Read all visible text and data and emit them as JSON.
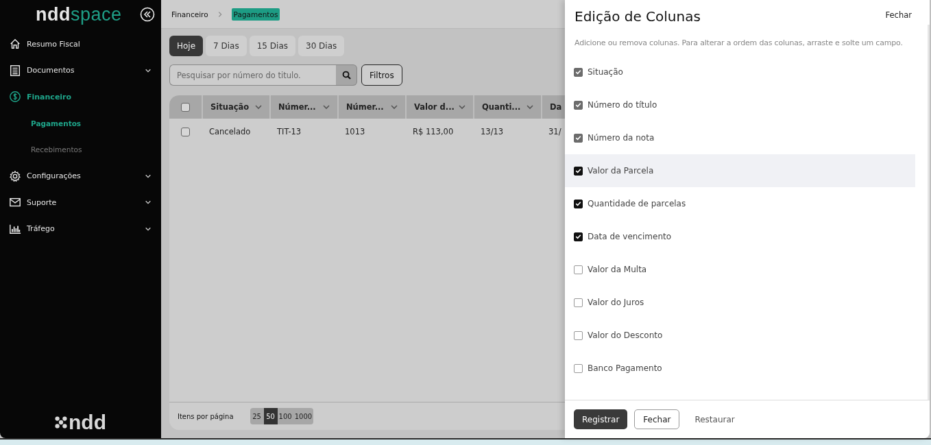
{
  "sidebar": {
    "logo": {
      "part_1": "ndd",
      "part_2": "space"
    },
    "items": [
      {
        "label": "Resumo Fiscal",
        "selected": false
      },
      {
        "label": "Documentos",
        "selected": false,
        "expanded": false
      },
      {
        "label": "Financeiro",
        "selected": true,
        "expanded": true,
        "children": [
          {
            "label": "Pagamentos",
            "selected": true
          },
          {
            "label": "Recebimentos",
            "selected": false
          }
        ]
      },
      {
        "label": "Configurações",
        "selected": false,
        "expanded": false
      },
      {
        "label": "Suporte",
        "selected": false,
        "expanded": false
      },
      {
        "label": "Tráfego",
        "selected": false,
        "expanded": false
      }
    ],
    "footer_logo": "ndd"
  },
  "breadcrumb": [
    {
      "label": "Financeiro",
      "selected": false
    },
    {
      "label": "Pagamentos",
      "selected": true
    }
  ],
  "period_tabs": [
    {
      "label": "Hoje",
      "selected": true
    },
    {
      "label": "7 Dias",
      "selected": false
    },
    {
      "label": "15 Dias",
      "selected": false
    },
    {
      "label": "30 Dias",
      "selected": false
    }
  ],
  "search": {
    "placeholder": "Pesquisar por número do titulo."
  },
  "filters_button": "Filtros",
  "table": {
    "select_all_checked": false,
    "columns": [
      "Situação",
      "Númer...",
      "Númer...",
      "Valor d...",
      "Quanti...",
      "Da"
    ],
    "rows": [
      {
        "checked": false,
        "cells": [
          "Cancelado",
          "TIT-13",
          "1013",
          "R$ 113,00",
          "13/13",
          "31/"
        ]
      }
    ]
  },
  "pagination": {
    "label": "Itens por página",
    "sizes": [
      {
        "label": "25",
        "selected": false
      },
      {
        "label": "50",
        "selected": true
      },
      {
        "label": "100",
        "selected": false
      },
      {
        "label": "1000",
        "selected": false
      }
    ]
  },
  "drawer": {
    "title": "Edição de Colunas",
    "close_link": "Fechar",
    "description": "Adicione ou remova colunas. Para alterar a ordem das colunas, arraste e solte um campo.",
    "options": [
      {
        "label": "Situação",
        "checked": true,
        "disabled": true,
        "highlighted": false
      },
      {
        "label": "Número do título",
        "checked": true,
        "disabled": true,
        "highlighted": false
      },
      {
        "label": "Número da nota",
        "checked": true,
        "disabled": true,
        "highlighted": false
      },
      {
        "label": "Valor da Parcela",
        "checked": true,
        "disabled": false,
        "highlighted": true
      },
      {
        "label": "Quantidade de parcelas",
        "checked": true,
        "disabled": false,
        "highlighted": false
      },
      {
        "label": "Data de vencimento",
        "checked": true,
        "disabled": false,
        "highlighted": false
      },
      {
        "label": "Valor da Multa",
        "checked": false,
        "disabled": false,
        "highlighted": false
      },
      {
        "label": "Valor do Juros",
        "checked": false,
        "disabled": false,
        "highlighted": false
      },
      {
        "label": "Valor do Desconto",
        "checked": false,
        "disabled": false,
        "highlighted": false
      },
      {
        "label": "Banco Pagamento",
        "checked": false,
        "disabled": false,
        "highlighted": false
      }
    ],
    "buttons": [
      {
        "label": "Registrar",
        "kind": "primary"
      },
      {
        "label": "Fechar",
        "kind": "outline"
      },
      {
        "label": "Restaurar",
        "kind": "text"
      }
    ]
  }
}
